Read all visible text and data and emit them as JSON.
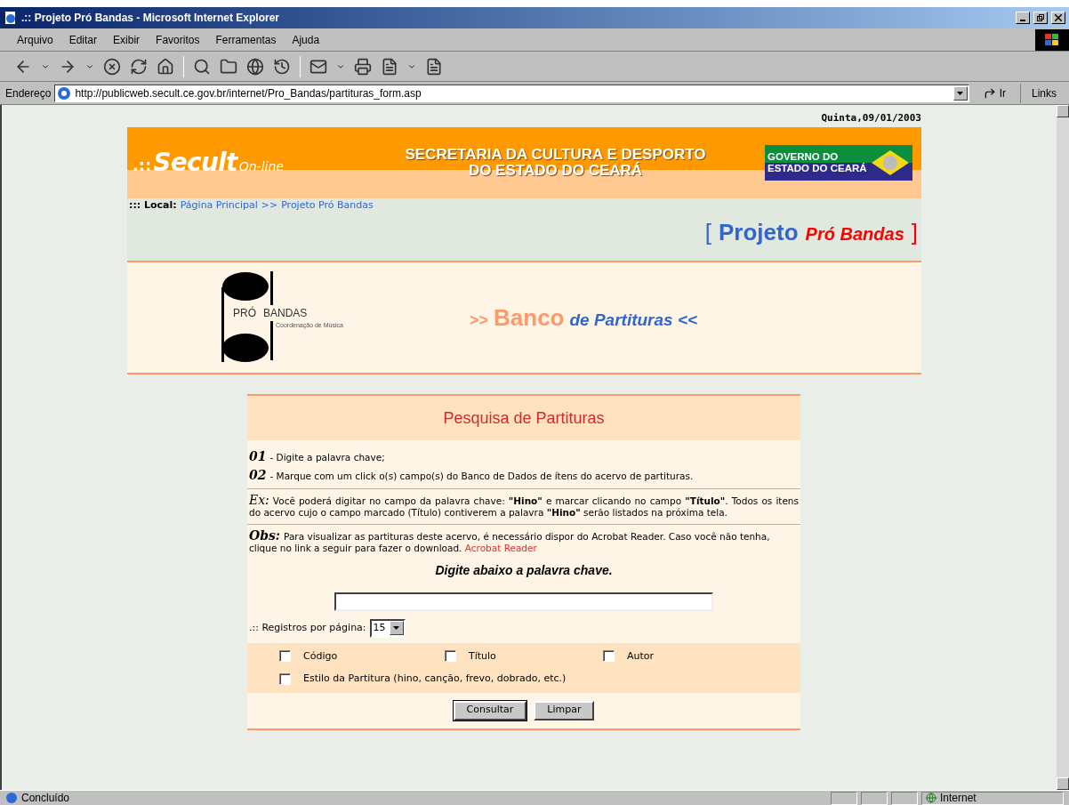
{
  "window": {
    "title": ".:: Projeto Pró Bandas - Microsoft Internet Explorer"
  },
  "menu": [
    "Arquivo",
    "Editar",
    "Exibir",
    "Favoritos",
    "Ferramentas",
    "Ajuda"
  ],
  "address": {
    "label": "Endereço",
    "url": "http://publicweb.secult.ce.gov.br/internet/Pro_Bandas/partituras_form.asp",
    "go": "Ir",
    "links": "Links"
  },
  "page": {
    "date": "Quinta,09/01/2003",
    "banner": {
      "logo_prefix": ".::",
      "logo_main": "Secult",
      "logo_sub": "On-line",
      "title_lines": [
        "SECRETARIA DA CULTURA E DESPORTO",
        "DO ESTADO DO CEARÁ"
      ],
      "badge_lines": [
        "GOVERNO DO",
        "ESTADO DO CEARÁ"
      ]
    },
    "breadcrumb": {
      "label": "::: Local:",
      "items": [
        "Página Principal",
        "Projeto Pró Bandas"
      ],
      "separator": ">>"
    },
    "project": {
      "open": "[",
      "word": "Projeto",
      "name": "Pró Bandas",
      "close": "]"
    },
    "logo": {
      "left": "PRÓ",
      "right": "BANDAS",
      "sub": "Coordenação de Música"
    },
    "section": {
      "prefix": ">>",
      "word": "Banco",
      "rest": "de Partituras <<"
    },
    "form": {
      "title": "Pesquisa de Partituras",
      "steps": [
        {
          "num": "01",
          "text": "- Digite a palavra chave;"
        },
        {
          "num": "02",
          "text": "- Marque com um click o(s) campo(s) do Banco de Dados de ítens do acervo de partituras."
        }
      ],
      "example": {
        "label": "Ex:",
        "text": "Você poderá digitar no campo da palavra chave: **\"Hino\"** e marcar clicando no campo **\"Título\"**. Todos os itens do acervo cujo o campo marcado (Título) contiverem a palavra **\"Hino\"** serão listados na próxima tela."
      },
      "obs": {
        "label": "Obs:",
        "text": "Para visualizar as partituras deste acervo, é necessário dispor do Acrobat Reader. Caso você não tenha, clique no link a seguir para fazer o download.",
        "link": "Acrobat Reader"
      },
      "prompt": "Digite abaixo a palavra chave.",
      "per_page": {
        "label": ".:: Registros por página:",
        "value": "15"
      },
      "checkboxes": [
        {
          "label": "Código",
          "checked": false
        },
        {
          "label": "Título",
          "checked": false
        },
        {
          "label": "Autor",
          "checked": false
        },
        {
          "label": "Estilo da Partitura (hino, canção, frevo, dobrado, etc.)",
          "checked": false
        }
      ],
      "buttons": [
        "Consultar",
        "Limpar"
      ]
    }
  },
  "status_bar": {
    "text": "Concluído",
    "zone": "Internet"
  }
}
